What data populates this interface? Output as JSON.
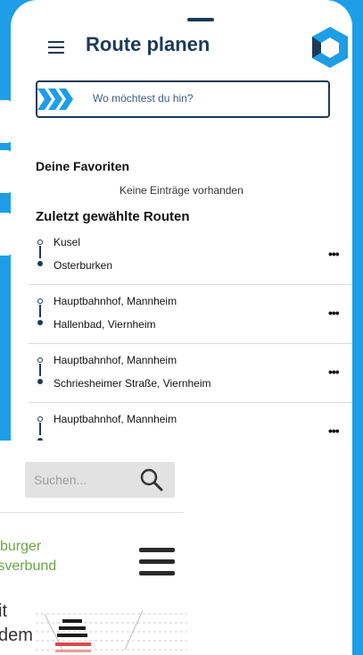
{
  "header": {
    "title": "Route planen",
    "menu_icon": "hamburger-menu-icon",
    "logo_icon": "hexagon-logo-icon"
  },
  "search": {
    "placeholder": "Wo möchtest du hin?",
    "icon": "chevrons-right-icon"
  },
  "favorites": {
    "title": "Deine Favoriten",
    "empty_text": "Keine Einträge vorhanden"
  },
  "recent": {
    "title": "Zuletzt gewählte Routen",
    "routes": [
      {
        "from": "Kusel",
        "to": "Osterburken",
        "more": "•••"
      },
      {
        "from": "Hauptbahnhof, Mannheim",
        "to": "Hallenbad, Viernheim",
        "more": "•••"
      },
      {
        "from": "Hauptbahnhof, Mannheim",
        "to": "Schriesheimer Straße, Viernheim",
        "more": "•••"
      },
      {
        "from": "Hauptbahnhof, Mannheim",
        "to": "",
        "more": "•••"
      }
    ]
  },
  "website_overlay": {
    "search_placeholder": "Suchen...",
    "search_icon": "magnifier-icon",
    "brand_line1": "sburger",
    "brand_line2": "rsverbund",
    "menu_icon": "hamburger-menu-icon",
    "text_line1": "it",
    "text_line2": "dem"
  },
  "colors": {
    "background": "#1d9ee6",
    "primary": "#1b3a57",
    "accent": "#1d9ee6",
    "brand_green": "#6aa444"
  }
}
